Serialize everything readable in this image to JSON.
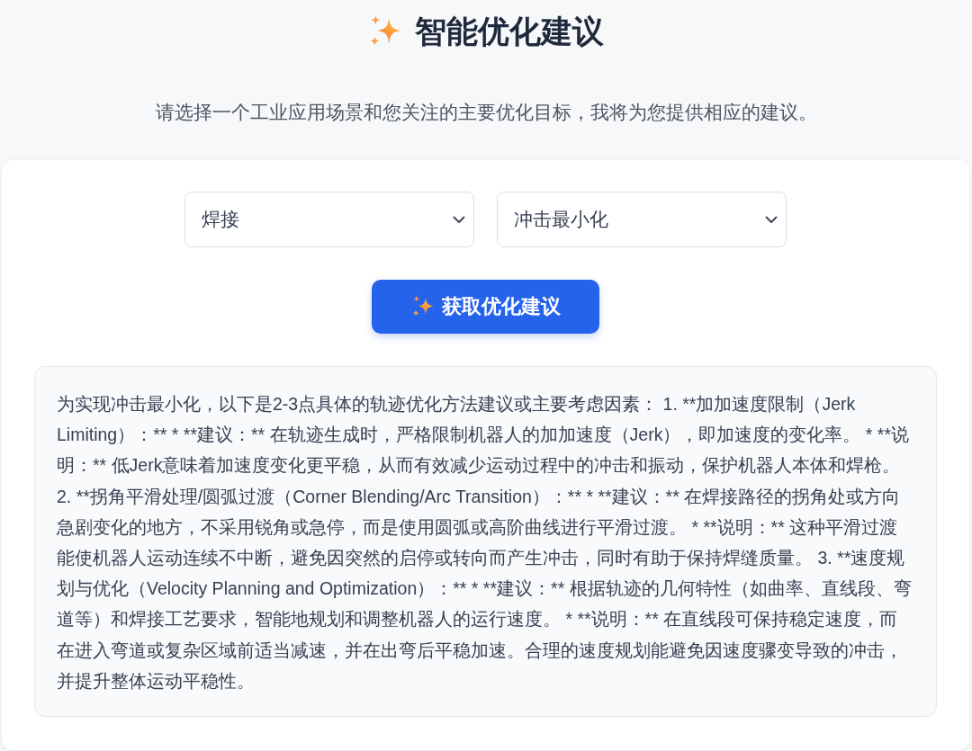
{
  "header": {
    "title": "智能优化建议",
    "subtitle": "请选择一个工业应用场景和您关注的主要优化目标，我将为您提供相应的建议。"
  },
  "form": {
    "selects": [
      {
        "value": "焊接"
      },
      {
        "value": "冲击最小化"
      }
    ],
    "button": {
      "label": "获取优化建议"
    }
  },
  "result": {
    "text": "为实现冲击最小化，以下是2-3点具体的轨迹优化方法建议或主要考虑因素： 1. **加加速度限制（Jerk Limiting）：** * **建议：** 在轨迹生成时，严格限制机器人的加加速度（Jerk），即加速度的变化率。 * **说明：** 低Jerk意味着加速度变化更平稳，从而有效减少运动过程中的冲击和振动，保护机器人本体和焊枪。 2. **拐角平滑处理/圆弧过渡（Corner Blending/Arc Transition）：** * **建议：** 在焊接路径的拐角处或方向急剧变化的地方，不采用锐角或急停，而是使用圆弧或高阶曲线进行平滑过渡。 * **说明：** 这种平滑过渡能使机器人运动连续不中断，避免因突然的启停或转向而产生冲击，同时有助于保持焊缝质量。 3. **速度规划与优化（Velocity Planning and Optimization）：** * **建议：** 根据轨迹的几何特性（如曲率、直线段、弯道等）和焊接工艺要求，智能地规划和调整机器人的运行速度。 * **说明：** 在直线段可保持稳定速度，而在进入弯道或复杂区域前适当减速，并在出弯后平稳加速。合理的速度规划能避免因速度骤变导致的冲击，并提升整体运动平稳性。"
  }
}
